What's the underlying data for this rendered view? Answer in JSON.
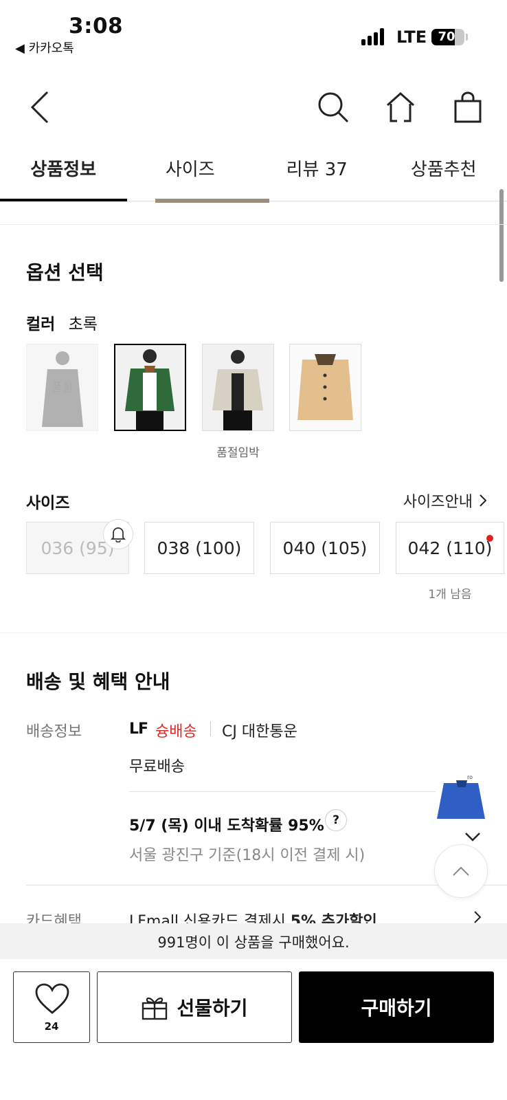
{
  "status_bar": {
    "time": "3:08",
    "back_app": "◀ 카카오톡",
    "network": "LTE",
    "battery": "70"
  },
  "nav": {
    "icons": [
      "back-arrow-icon",
      "search-icon",
      "home-icon",
      "shopping-bag-icon"
    ]
  },
  "tabs": [
    {
      "label": "상품정보",
      "active": true
    },
    {
      "label": "사이즈",
      "active": false
    },
    {
      "label": "리뷰 37",
      "active": false
    },
    {
      "label": "상품추천",
      "active": false
    }
  ],
  "options": {
    "title": "옵션 선택",
    "color_label": "컬러",
    "color_value": "초록",
    "swatches": [
      {
        "state": "soldout",
        "label": "품절"
      },
      {
        "state": "selected",
        "label": ""
      },
      {
        "state": "normal",
        "label": "",
        "note": "품절임박"
      },
      {
        "state": "normal",
        "label": ""
      }
    ],
    "size_title": "사이즈",
    "size_guide": "사이즈안내",
    "sizes": [
      {
        "label": "036 (95)",
        "disabled": true
      },
      {
        "label": "038 (100)",
        "disabled": false
      },
      {
        "label": "040 (105)",
        "disabled": false
      },
      {
        "label": "042 (110)",
        "disabled": false,
        "note": "1개 남음"
      }
    ]
  },
  "shipping": {
    "title": "배송 및 혜택 안내",
    "info_label": "배송정보",
    "logo_text": "LF",
    "fast_label": "슝배송",
    "carrier": "CJ 대한통운",
    "free": "무료배송",
    "arrival": "5/7 (목) 이내 도착확률 95%",
    "question": "?",
    "arrival_sub": "서울 광진구 기준(18시 이전 결제 시)",
    "card_label": "카드혜택",
    "card_text": "LFmall 신용카드 결제시 ",
    "card_bold": "5% 추가할인"
  },
  "banner": "991명이 이 상품을 구매했어요.",
  "bottom": {
    "like_count": "24",
    "gift": "선물하기",
    "buy": "구매하기"
  },
  "colors": {
    "accent_red": "#e02a2a",
    "buy_bg": "#000000"
  }
}
